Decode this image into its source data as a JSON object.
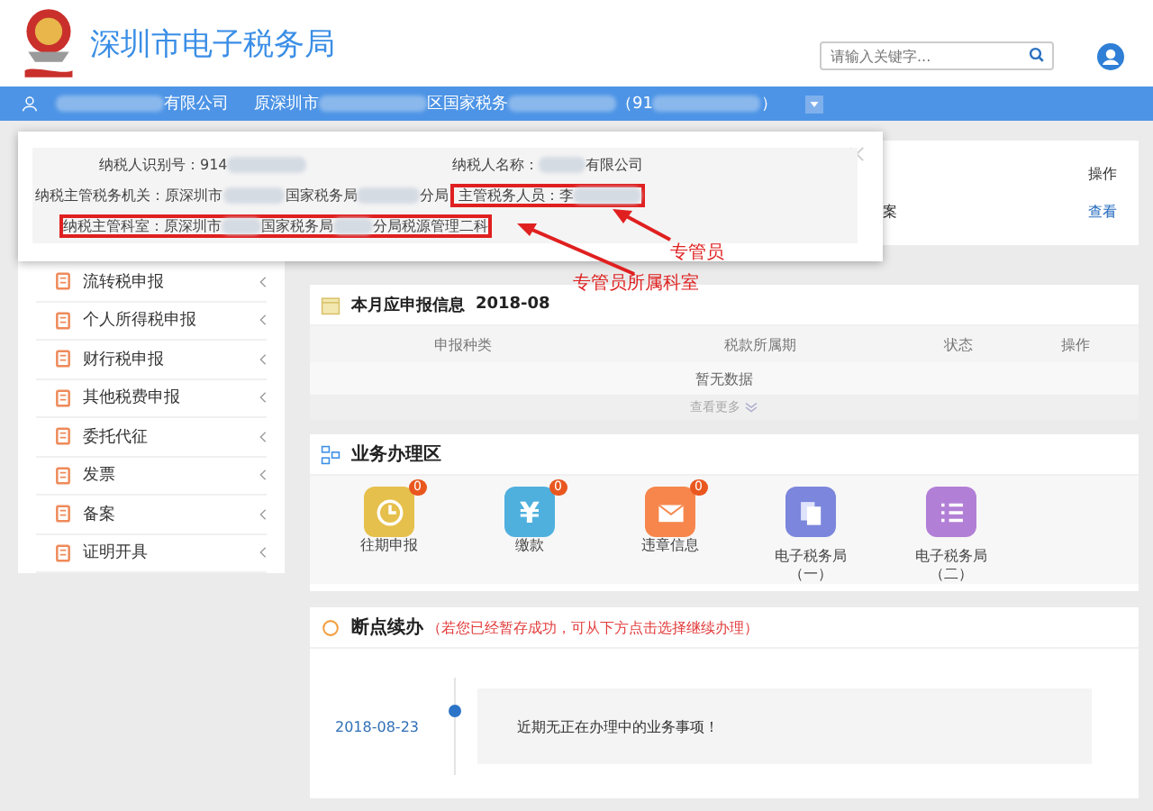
{
  "header": {
    "title": "深圳市电子税务局",
    "search": {
      "placeholder": "请输入关键字..."
    }
  },
  "account_bar": {
    "segments": [
      {
        "kind": "redacted"
      },
      {
        "kind": "text",
        "text": "有限公司"
      },
      {
        "kind": "gap"
      },
      {
        "kind": "text",
        "text": "原深圳市"
      },
      {
        "kind": "redacted"
      },
      {
        "kind": "text",
        "text": "区国家税务"
      },
      {
        "kind": "redacted"
      },
      {
        "kind": "text",
        "text": "（91"
      },
      {
        "kind": "redacted"
      },
      {
        "kind": "text",
        "text": "）"
      }
    ]
  },
  "popup": {
    "rows": [
      {
        "fields": [
          {
            "label": "纳税人识别号：",
            "value": [
              {
                "kind": "text",
                "text": "914"
              },
              {
                "kind": "redacted"
              }
            ],
            "highlighted": false
          },
          {
            "label": "纳税人名称：",
            "value": [
              {
                "kind": "redacted"
              },
              {
                "kind": "text",
                "text": "有限公司"
              }
            ],
            "highlighted": false
          }
        ]
      },
      {
        "fields": [
          {
            "label": "纳税主管税务机关：",
            "value": [
              {
                "kind": "text",
                "text": "原深圳市"
              },
              {
                "kind": "redacted"
              },
              {
                "kind": "text",
                "text": "国家税务局"
              },
              {
                "kind": "redacted"
              },
              {
                "kind": "text",
                "text": "分局"
              }
            ],
            "highlighted": false
          },
          {
            "label": "主管税务人员：",
            "value": [
              {
                "kind": "text",
                "text": "李"
              },
              {
                "kind": "redacted"
              }
            ],
            "highlighted": true
          }
        ]
      },
      {
        "fields": [
          {
            "label": "纳税主管科室：",
            "value": [
              {
                "kind": "text",
                "text": "原深圳市"
              },
              {
                "kind": "redacted"
              },
              {
                "kind": "text",
                "text": "国家税务局"
              },
              {
                "kind": "redacted"
              },
              {
                "kind": "text",
                "text": "分局税源管理二科"
              }
            ],
            "highlighted": true
          }
        ]
      }
    ]
  },
  "annotations": [
    {
      "label": "专管员"
    },
    {
      "label": "专管员所属科室"
    }
  ],
  "behind_panel": {
    "column": "操作",
    "cell": "案",
    "link": "查看"
  },
  "sidebar": {
    "items": [
      {
        "label": "流转税申报"
      },
      {
        "label": "个人所得税申报"
      },
      {
        "label": "财行税申报"
      },
      {
        "label": "其他税费申报"
      },
      {
        "label": "委托代征"
      },
      {
        "label": "发票"
      },
      {
        "label": "备案"
      },
      {
        "label": "证明开具"
      }
    ]
  },
  "declaration": {
    "title": "本月应申报信息",
    "period": "2018-08",
    "columns": [
      "申报种类",
      "税款所属期",
      "状态",
      "操作"
    ],
    "empty": "暂无数据",
    "more": "查看更多"
  },
  "business": {
    "title": "业务办理区",
    "tiles": [
      {
        "kind": "clock",
        "lines": [
          "往期申报"
        ],
        "badge": "0",
        "color": "#e6c04c"
      },
      {
        "kind": "yen",
        "glyph": "¥",
        "lines": [
          "缴款"
        ],
        "badge": "0",
        "color": "#4fb0de"
      },
      {
        "kind": "mail",
        "lines": [
          "违章信息"
        ],
        "badge": "0",
        "color": "#f7864c"
      },
      {
        "kind": "docs",
        "lines": [
          "电子税务局",
          "（一）"
        ],
        "color": "#7b86dc"
      },
      {
        "kind": "list",
        "lines": [
          "电子税务局",
          "（二）"
        ],
        "color": "#b27fd6"
      }
    ]
  },
  "resume": {
    "title": "断点续办",
    "note": "（若您已经暂存成功，可从下方点击选择继续办理）",
    "entries": [
      {
        "date": "2018-08-23",
        "message": "近期无正在办理中的业务事项！"
      }
    ]
  }
}
